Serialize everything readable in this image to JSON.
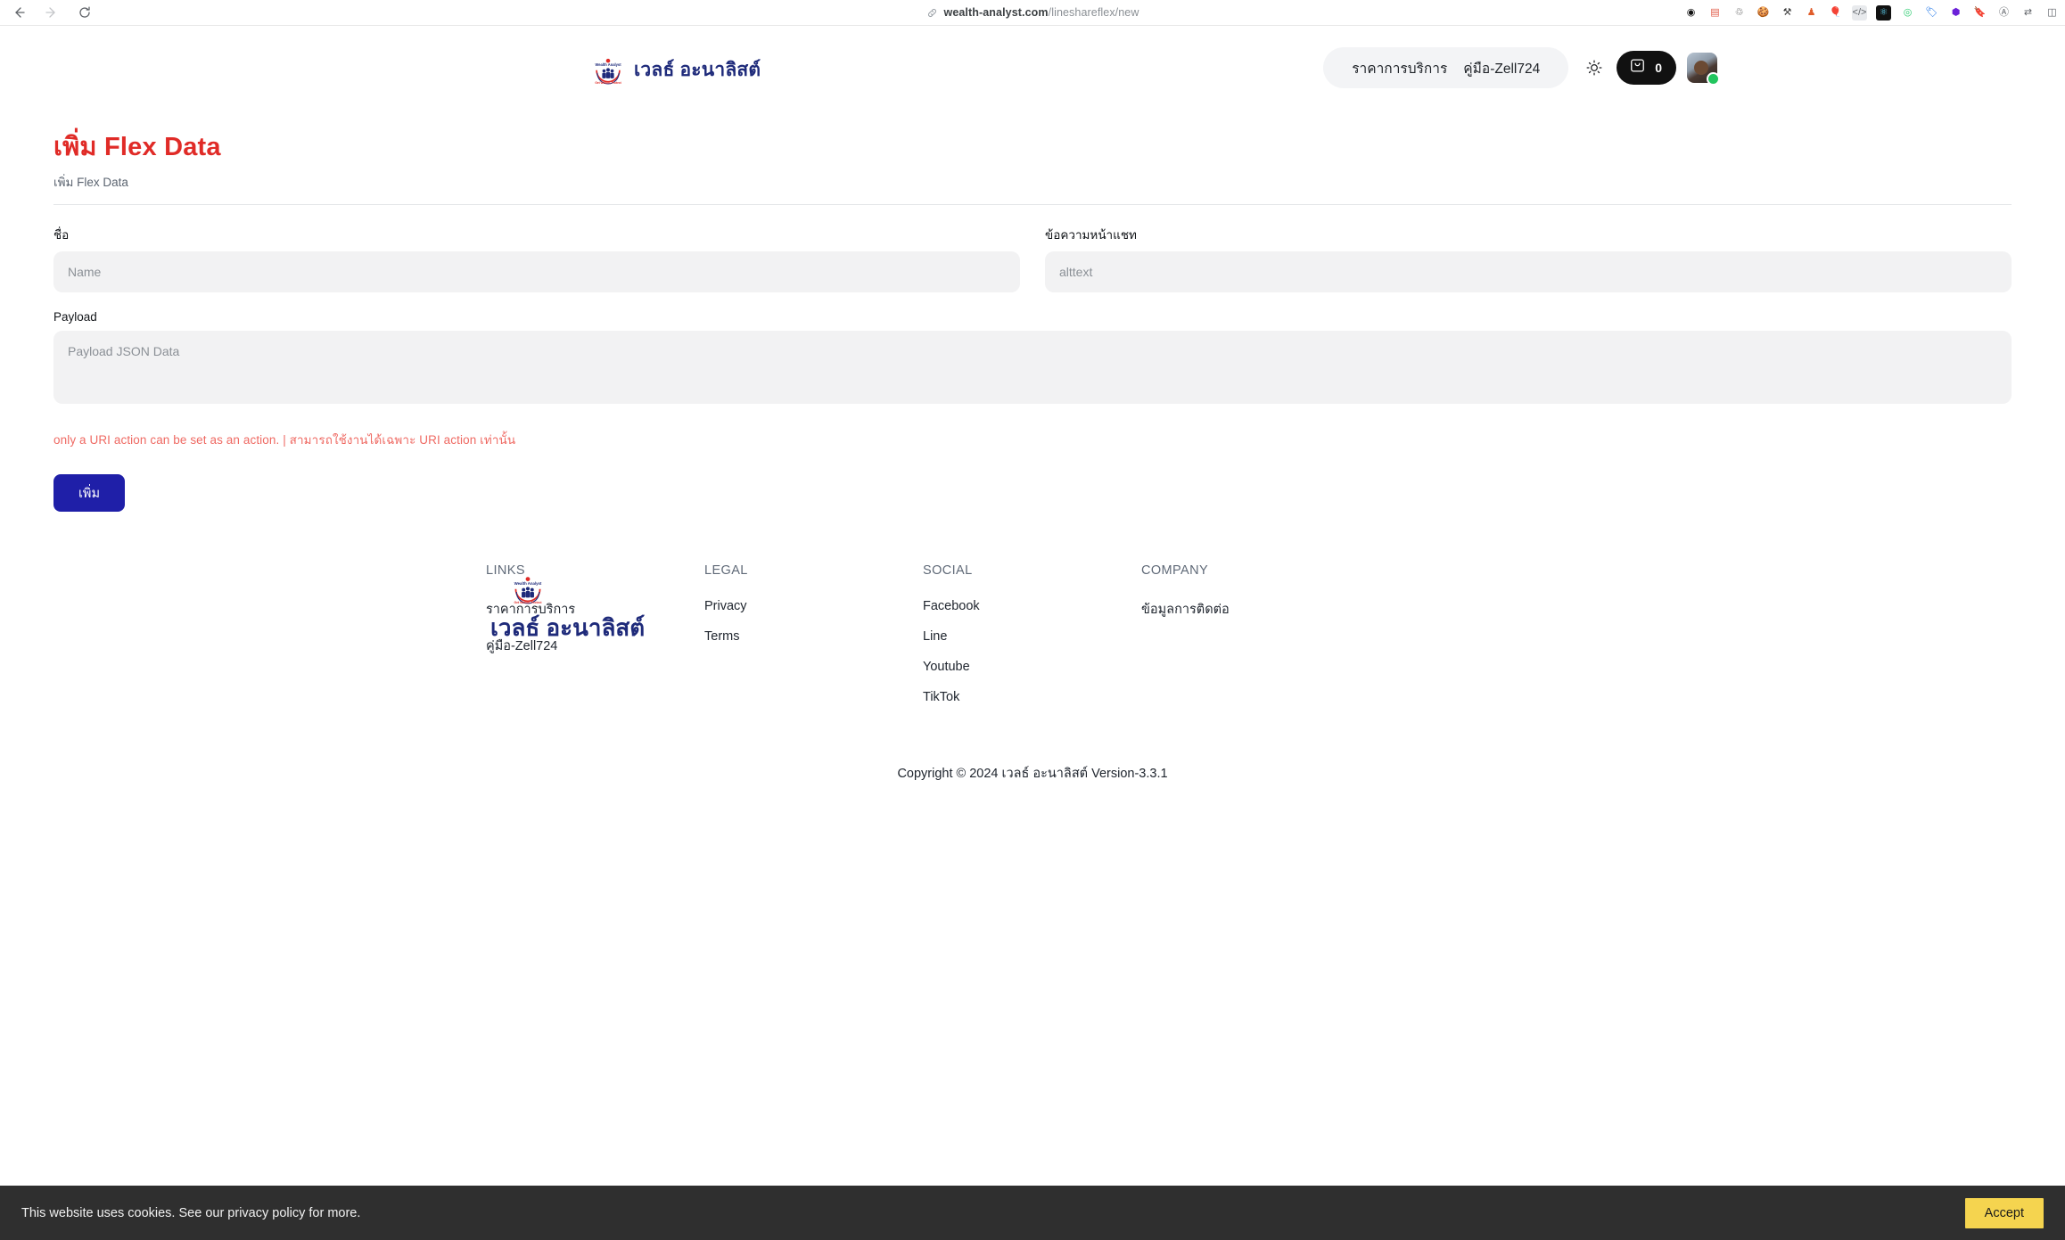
{
  "browser": {
    "back_icon": "back-arrow-icon",
    "forward_icon": "forward-arrow-icon",
    "reload_icon": "reload-icon",
    "url_domain": "wealth-analyst.com",
    "url_path": "/lineshareflex/new",
    "url_full": "wealth-analyst.com/lineshareflex/new",
    "extensions": [
      {
        "name": "colorpicker-extension-icon",
        "glyph": "◉",
        "bg": "#ffffff",
        "fg": "#111111"
      },
      {
        "name": "notes-extension-icon",
        "glyph": "▤",
        "bg": "#ffffff",
        "fg": "#e05c4a"
      },
      {
        "name": "recycle-extension-icon",
        "glyph": "♲",
        "bg": "#ffffff",
        "fg": "#4a4a4a"
      },
      {
        "name": "cookie-extension-icon",
        "glyph": "🍪",
        "bg": "#ffffff",
        "fg": "#8a5a2b"
      },
      {
        "name": "wrench-extension-icon",
        "glyph": "⚒",
        "bg": "#ffffff",
        "fg": "#3a3a3a"
      },
      {
        "name": "chess-pawn-extension-icon",
        "glyph": "♟",
        "bg": "#ffffff",
        "fg": "#e05c2a"
      },
      {
        "name": "balloons-extension-icon",
        "glyph": "🎈",
        "bg": "#ffffff",
        "fg": "#e0c040"
      },
      {
        "name": "code-extension-icon",
        "glyph": "</>",
        "bg": "#e8eaed",
        "fg": "#5f6368"
      },
      {
        "name": "react-extension-icon",
        "glyph": "⚛",
        "bg": "#111111",
        "fg": "#61dafb"
      },
      {
        "name": "atom-extension-icon",
        "glyph": "◎",
        "bg": "#ffffff",
        "fg": "#2ecc71"
      },
      {
        "name": "tag-extension-icon",
        "glyph": "🏷",
        "bg": "#ffffff",
        "fg": "#1a73e8"
      },
      {
        "name": "hexagon-extension-icon",
        "glyph": "⬢",
        "bg": "#ffffff",
        "fg": "#6b21d8"
      },
      {
        "name": "bookmark-extension-icon",
        "glyph": "🔖",
        "bg": "#ffffff",
        "fg": "#1a73e8"
      },
      {
        "name": "translate-extension-icon",
        "glyph": "Ⓐ",
        "bg": "#ffffff",
        "fg": "#5f6368"
      },
      {
        "name": "settings-extension-icon",
        "glyph": "⇄",
        "bg": "#ffffff",
        "fg": "#5f6368"
      },
      {
        "name": "split-view-icon",
        "glyph": "◫",
        "bg": "#ffffff",
        "fg": "#5f6368"
      }
    ]
  },
  "header": {
    "brand_name": "เวลธ์ อะนาลิสต์",
    "logo_alt": "Wealth Analyst",
    "logo_top_text": "Wealth Analyst",
    "logo_arc_text": "Get Wealth, Protect Wealth",
    "nav": [
      {
        "label": "ราคาการบริการ",
        "name": "nav-pricing"
      },
      {
        "label": "คู่มือ-Zell724",
        "name": "nav-manual-zell724"
      }
    ],
    "theme_icon": "sun-icon",
    "cart_icon": "inbox-icon",
    "cart_count": "0",
    "avatar_name": "user-avatar",
    "status": "online"
  },
  "page": {
    "title": "เพิ่ม Flex Data",
    "subtitle": "เพิ่ม Flex Data",
    "title_color": "#e02b27"
  },
  "form": {
    "name_label": "ชื่อ",
    "name_placeholder": "Name",
    "name_value": "",
    "alttext_label": "ข้อความหน้าแชท",
    "alttext_placeholder": "alttext",
    "alttext_value": "",
    "payload_label": "Payload",
    "payload_placeholder": "Payload JSON Data",
    "payload_value": "",
    "error_message": "only a URI action can be set as an action. | สามารถใช้งานได้เฉพาะ URI action เท่านั้น",
    "error_color": "#ef6a63",
    "submit_label": "เพิ่ม",
    "submit_color": "#1f1fa8"
  },
  "footer": {
    "brand_name": "เวลธ์ อะนาลิสต์",
    "columns": [
      {
        "name": "links",
        "title": "LINKS",
        "items": [
          {
            "label": "ราคาการบริการ",
            "name": "footer-link-pricing"
          },
          {
            "label": "คู่มือ-Zell724",
            "name": "footer-link-manual"
          }
        ]
      },
      {
        "name": "legal",
        "title": "LEGAL",
        "items": [
          {
            "label": "Privacy",
            "name": "footer-link-privacy"
          },
          {
            "label": "Terms",
            "name": "footer-link-terms"
          }
        ]
      },
      {
        "name": "social",
        "title": "SOCIAL",
        "items": [
          {
            "label": "Facebook",
            "name": "footer-link-facebook"
          },
          {
            "label": "Line",
            "name": "footer-link-line"
          },
          {
            "label": "Youtube",
            "name": "footer-link-youtube"
          },
          {
            "label": "TikTok",
            "name": "footer-link-tiktok"
          }
        ]
      },
      {
        "name": "company",
        "title": "COMPANY",
        "items": [
          {
            "label": "ข้อมูลการติดต่อ",
            "name": "footer-link-contact"
          }
        ]
      }
    ],
    "copyright": "Copyright © 2024 เวลธ์ อะนาลิสต์ Version-3.3.1"
  },
  "cookie": {
    "message": "This website uses cookies. See our privacy policy for more.",
    "accept_label": "Accept",
    "accept_color": "#f5d44f",
    "bar_color": "#2f2f2f"
  }
}
